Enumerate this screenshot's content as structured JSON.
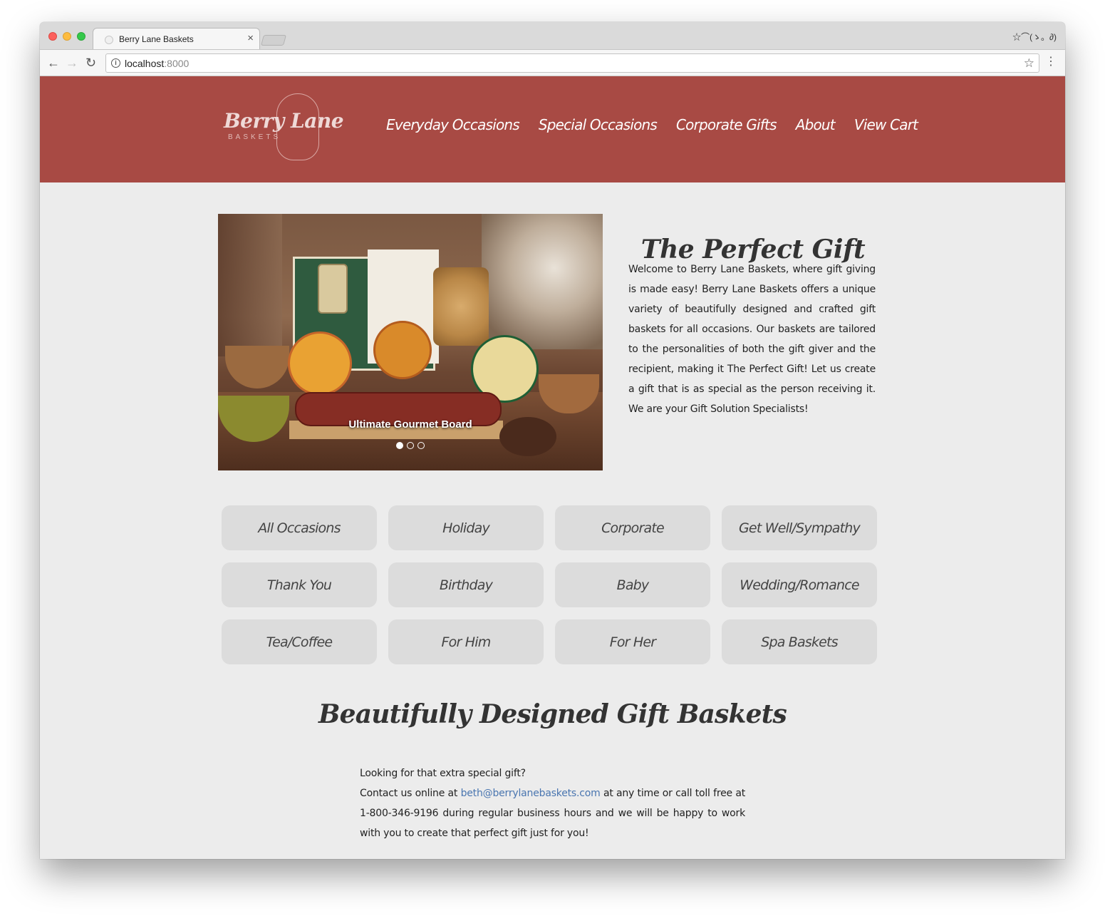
{
  "browser": {
    "tab_title": "Berry Lane Baskets",
    "tab_close": "×",
    "url_host": "localhost",
    "url_port": ":8000",
    "tabbar_right_text": "☆⌒(ゝ。∂)"
  },
  "site": {
    "logo_text": "Berry Lane",
    "logo_sub": "BASKETS",
    "nav": [
      {
        "label": "Everyday Occasions"
      },
      {
        "label": "Special Occasions"
      },
      {
        "label": "Corporate Gifts"
      },
      {
        "label": "About"
      },
      {
        "label": "View Cart"
      }
    ],
    "hero": {
      "caption": "Ultimate Gourmet Board",
      "slide_count": 3,
      "active_slide": 1
    },
    "perfect_gift": {
      "title": "The Perfect Gift",
      "body": "Welcome to Berry Lane Baskets, where gift giving is made easy! Berry Lane Baskets offers a unique variety of beautifully designed and crafted gift baskets for all occasions. Our baskets are tailored to the personalities of both the gift giver and the recipient, making it The Perfect Gift! Let us create a gift that is as special as the person receiving it. We are your Gift Solution Specialists!"
    },
    "categories": [
      {
        "label": "All Occasions"
      },
      {
        "label": "Holiday"
      },
      {
        "label": "Corporate"
      },
      {
        "label": "Get Well/Sympathy"
      },
      {
        "label": "Thank You"
      },
      {
        "label": "Birthday"
      },
      {
        "label": "Baby"
      },
      {
        "label": "Wedding/Romance"
      },
      {
        "label": "Tea/Coffee"
      },
      {
        "label": "For Him"
      },
      {
        "label": "For Her"
      },
      {
        "label": "Spa Baskets"
      }
    ],
    "designed": {
      "title": "Beautifully Designed Gift Baskets",
      "line1": "Looking for that extra special gift?",
      "contact_prefix": "Contact us online at ",
      "email": "beth@berrylanebaskets.com",
      "contact_suffix": " at any time or call toll free at 1-800-346-9196 during regular business hours and we will be happy to work with you to create that perfect gift just for you!"
    },
    "colors": {
      "header_bg": "#a84a44",
      "page_bg": "#ececec",
      "button_bg": "#dcdcdc",
      "link": "#4a76b0"
    }
  }
}
